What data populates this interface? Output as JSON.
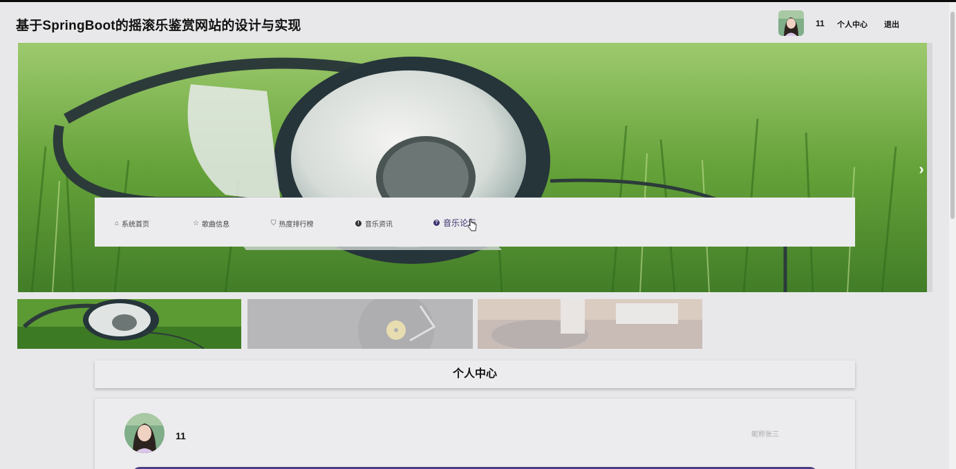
{
  "app": {
    "title": "基于SpringBoot的摇滚乐鉴赏网站的设计与实现"
  },
  "header": {
    "avatar_icon": "user-avatar-photo",
    "username": "11",
    "user_center_label": "个人中心",
    "logout_label": "退出"
  },
  "banner": {
    "next_icon": "chevron-right-icon",
    "next_glyph": "›"
  },
  "nav": {
    "items": [
      {
        "label": "系统首页",
        "icon": "home-icon",
        "glyph": "⌂"
      },
      {
        "label": "歌曲信息",
        "icon": "star-icon",
        "glyph": "☆"
      },
      {
        "label": "热度排行榜",
        "icon": "bag-icon",
        "glyph": "⛉"
      },
      {
        "label": "音乐资讯",
        "icon": "info-icon",
        "glyph": "!"
      },
      {
        "label": "音乐论坛",
        "icon": "question-icon",
        "glyph": "?"
      }
    ],
    "active": "音乐论坛"
  },
  "section": {
    "title": "个人中心"
  },
  "profile": {
    "username": "11",
    "nickname": "昵称张三"
  },
  "colors": {
    "accent": "#3b3470",
    "bar": "#4a3f86"
  }
}
